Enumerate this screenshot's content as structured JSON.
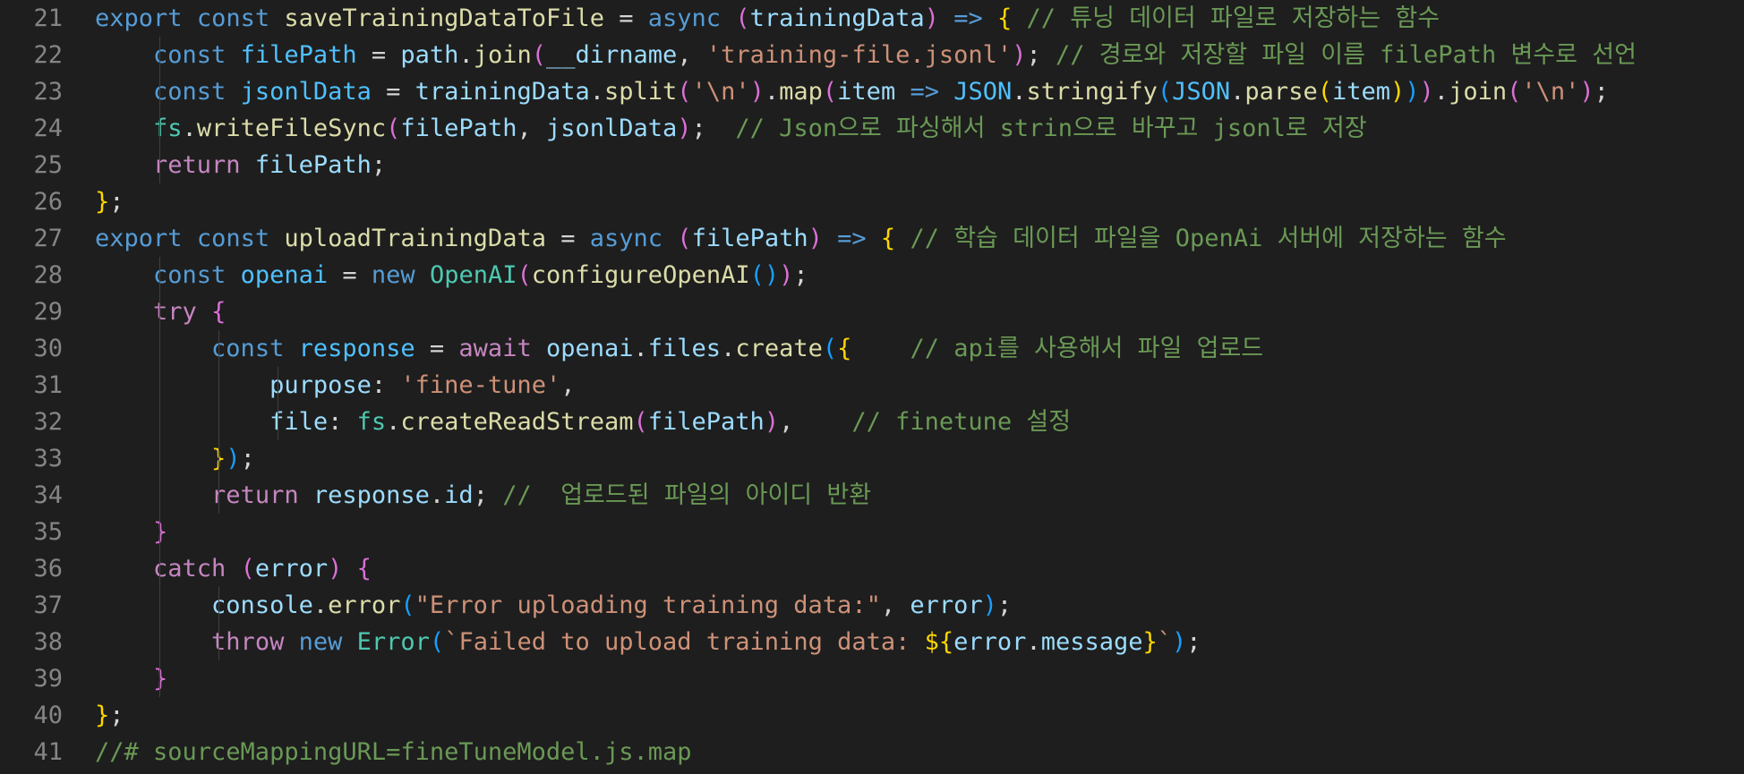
{
  "editor": {
    "theme_colors": {
      "background": "#1e1e1e",
      "line_number": "#858585",
      "keyword": "#569cd6",
      "control": "#c586c0",
      "function": "#dcdcaa",
      "variable": "#9cdcfe",
      "constant": "#4fc1ff",
      "type": "#4ec9b0",
      "string": "#ce9178",
      "comment": "#6a9955",
      "bracket_1": "#ffd700",
      "bracket_2": "#da70d6",
      "bracket_3": "#179fff"
    },
    "lines": [
      {
        "num": "21",
        "indent": 0,
        "tokens": [
          [
            "kw",
            "export"
          ],
          [
            "plain",
            " "
          ],
          [
            "kw",
            "const"
          ],
          [
            "plain",
            " "
          ],
          [
            "fn",
            "saveTrainingDataToFile"
          ],
          [
            "plain",
            " = "
          ],
          [
            "kw",
            "async"
          ],
          [
            "plain",
            " "
          ],
          [
            "b2",
            "("
          ],
          [
            "var",
            "trainingData"
          ],
          [
            "b2",
            ")"
          ],
          [
            "plain",
            " "
          ],
          [
            "kw",
            "=>"
          ],
          [
            "plain",
            " "
          ],
          [
            "b1",
            "{"
          ],
          [
            "plain",
            " "
          ],
          [
            "cmt",
            "// 튜닝 데이터 파일로 저장하는 함수"
          ]
        ]
      },
      {
        "num": "22",
        "indent": 1,
        "tokens": [
          [
            "kw",
            "const"
          ],
          [
            "plain",
            " "
          ],
          [
            "const",
            "filePath"
          ],
          [
            "plain",
            " = "
          ],
          [
            "var",
            "path"
          ],
          [
            "plain",
            "."
          ],
          [
            "fn",
            "join"
          ],
          [
            "b2",
            "("
          ],
          [
            "var",
            "__dirname"
          ],
          [
            "plain",
            ", "
          ],
          [
            "str",
            "'training-file.jsonl'"
          ],
          [
            "b2",
            ")"
          ],
          [
            "plain",
            "; "
          ],
          [
            "cmt",
            "// 경로와 저장할 파일 이름 filePath 변수로 선언"
          ]
        ]
      },
      {
        "num": "23",
        "indent": 1,
        "tokens": [
          [
            "kw",
            "const"
          ],
          [
            "plain",
            " "
          ],
          [
            "const",
            "jsonlData"
          ],
          [
            "plain",
            " = "
          ],
          [
            "var",
            "trainingData"
          ],
          [
            "plain",
            "."
          ],
          [
            "fn",
            "split"
          ],
          [
            "b2",
            "("
          ],
          [
            "str",
            "'\\n'"
          ],
          [
            "b2",
            ")"
          ],
          [
            "plain",
            "."
          ],
          [
            "fn",
            "map"
          ],
          [
            "b2",
            "("
          ],
          [
            "var",
            "item"
          ],
          [
            "plain",
            " "
          ],
          [
            "kw",
            "=>"
          ],
          [
            "plain",
            " "
          ],
          [
            "const",
            "JSON"
          ],
          [
            "plain",
            "."
          ],
          [
            "fn",
            "stringify"
          ],
          [
            "b3",
            "("
          ],
          [
            "const",
            "JSON"
          ],
          [
            "plain",
            "."
          ],
          [
            "fn",
            "parse"
          ],
          [
            "b1",
            "("
          ],
          [
            "var",
            "item"
          ],
          [
            "b1",
            ")"
          ],
          [
            "b3",
            ")"
          ],
          [
            "b2",
            ")"
          ],
          [
            "plain",
            "."
          ],
          [
            "fn",
            "join"
          ],
          [
            "b2",
            "("
          ],
          [
            "str",
            "'\\n'"
          ],
          [
            "b2",
            ")"
          ],
          [
            "plain",
            ";"
          ]
        ]
      },
      {
        "num": "24",
        "indent": 1,
        "tokens": [
          [
            "type",
            "fs"
          ],
          [
            "plain",
            "."
          ],
          [
            "fn",
            "writeFileSync"
          ],
          [
            "b2",
            "("
          ],
          [
            "var",
            "filePath"
          ],
          [
            "plain",
            ", "
          ],
          [
            "var",
            "jsonlData"
          ],
          [
            "b2",
            ")"
          ],
          [
            "plain",
            ";  "
          ],
          [
            "cmt",
            "// Json으로 파싱해서 strin으로 바꾸고 jsonl로 저장"
          ]
        ]
      },
      {
        "num": "25",
        "indent": 1,
        "tokens": [
          [
            "ctrl",
            "return"
          ],
          [
            "plain",
            " "
          ],
          [
            "var",
            "filePath"
          ],
          [
            "plain",
            ";"
          ]
        ]
      },
      {
        "num": "26",
        "indent": 0,
        "tokens": [
          [
            "b1",
            "}"
          ],
          [
            "plain",
            ";"
          ]
        ]
      },
      {
        "num": "27",
        "indent": 0,
        "tokens": [
          [
            "kw",
            "export"
          ],
          [
            "plain",
            " "
          ],
          [
            "kw",
            "const"
          ],
          [
            "plain",
            " "
          ],
          [
            "fn",
            "uploadTrainingData"
          ],
          [
            "plain",
            " = "
          ],
          [
            "kw",
            "async"
          ],
          [
            "plain",
            " "
          ],
          [
            "b2",
            "("
          ],
          [
            "var",
            "filePath"
          ],
          [
            "b2",
            ")"
          ],
          [
            "plain",
            " "
          ],
          [
            "kw",
            "=>"
          ],
          [
            "plain",
            " "
          ],
          [
            "b1",
            "{"
          ],
          [
            "plain",
            " "
          ],
          [
            "cmt",
            "// 학습 데이터 파일을 OpenAi 서버에 저장하는 함수"
          ]
        ]
      },
      {
        "num": "28",
        "indent": 1,
        "tokens": [
          [
            "kw",
            "const"
          ],
          [
            "plain",
            " "
          ],
          [
            "const",
            "openai"
          ],
          [
            "plain",
            " = "
          ],
          [
            "kw",
            "new"
          ],
          [
            "plain",
            " "
          ],
          [
            "type",
            "OpenAI"
          ],
          [
            "b2",
            "("
          ],
          [
            "fn",
            "configureOpenAI"
          ],
          [
            "b3",
            "()"
          ],
          [
            "b2",
            ")"
          ],
          [
            "plain",
            ";"
          ]
        ]
      },
      {
        "num": "29",
        "indent": 1,
        "tokens": [
          [
            "ctrl",
            "try"
          ],
          [
            "plain",
            " "
          ],
          [
            "b2",
            "{"
          ]
        ]
      },
      {
        "num": "30",
        "indent": 2,
        "tokens": [
          [
            "kw",
            "const"
          ],
          [
            "plain",
            " "
          ],
          [
            "const",
            "response"
          ],
          [
            "plain",
            " = "
          ],
          [
            "ctrl",
            "await"
          ],
          [
            "plain",
            " "
          ],
          [
            "var",
            "openai"
          ],
          [
            "plain",
            "."
          ],
          [
            "var",
            "files"
          ],
          [
            "plain",
            "."
          ],
          [
            "fn",
            "create"
          ],
          [
            "b3",
            "("
          ],
          [
            "b1",
            "{"
          ],
          [
            "plain",
            "    "
          ],
          [
            "cmt",
            "// api를 사용해서 파일 업로드"
          ]
        ]
      },
      {
        "num": "31",
        "indent": 3,
        "tokens": [
          [
            "var",
            "purpose"
          ],
          [
            "plain",
            ": "
          ],
          [
            "str",
            "'fine-tune'"
          ],
          [
            "plain",
            ","
          ]
        ]
      },
      {
        "num": "32",
        "indent": 3,
        "tokens": [
          [
            "var",
            "file"
          ],
          [
            "plain",
            ": "
          ],
          [
            "type",
            "fs"
          ],
          [
            "plain",
            "."
          ],
          [
            "fn",
            "createReadStream"
          ],
          [
            "b2",
            "("
          ],
          [
            "var",
            "filePath"
          ],
          [
            "b2",
            ")"
          ],
          [
            "plain",
            ",    "
          ],
          [
            "cmt",
            "// finetune 설정"
          ]
        ]
      },
      {
        "num": "33",
        "indent": 2,
        "tokens": [
          [
            "b1",
            "}"
          ],
          [
            "b3",
            ")"
          ],
          [
            "plain",
            ";"
          ]
        ]
      },
      {
        "num": "34",
        "indent": 2,
        "tokens": [
          [
            "ctrl",
            "return"
          ],
          [
            "plain",
            " "
          ],
          [
            "var",
            "response"
          ],
          [
            "plain",
            "."
          ],
          [
            "var",
            "id"
          ],
          [
            "plain",
            "; "
          ],
          [
            "cmt",
            "//  업로드된 파일의 아이디 반환"
          ]
        ]
      },
      {
        "num": "35",
        "indent": 1,
        "tokens": [
          [
            "b2",
            "}"
          ]
        ]
      },
      {
        "num": "36",
        "indent": 1,
        "tokens": [
          [
            "ctrl",
            "catch"
          ],
          [
            "plain",
            " "
          ],
          [
            "b2",
            "("
          ],
          [
            "var",
            "error"
          ],
          [
            "b2",
            ")"
          ],
          [
            "plain",
            " "
          ],
          [
            "b2",
            "{"
          ]
        ]
      },
      {
        "num": "37",
        "indent": 2,
        "tokens": [
          [
            "var",
            "console"
          ],
          [
            "plain",
            "."
          ],
          [
            "fn",
            "error"
          ],
          [
            "b3",
            "("
          ],
          [
            "str",
            "\"Error uploading training data:\""
          ],
          [
            "plain",
            ", "
          ],
          [
            "var",
            "error"
          ],
          [
            "b3",
            ")"
          ],
          [
            "plain",
            ";"
          ]
        ]
      },
      {
        "num": "38",
        "indent": 2,
        "tokens": [
          [
            "ctrl",
            "throw"
          ],
          [
            "plain",
            " "
          ],
          [
            "kw",
            "new"
          ],
          [
            "plain",
            " "
          ],
          [
            "type",
            "Error"
          ],
          [
            "b3",
            "("
          ],
          [
            "str",
            "`Failed to upload training data: "
          ],
          [
            "b1",
            "${"
          ],
          [
            "var",
            "error"
          ],
          [
            "plain",
            "."
          ],
          [
            "var",
            "message"
          ],
          [
            "b1",
            "}"
          ],
          [
            "str",
            "`"
          ],
          [
            "b3",
            ")"
          ],
          [
            "plain",
            ";"
          ]
        ]
      },
      {
        "num": "39",
        "indent": 1,
        "tokens": [
          [
            "b2",
            "}"
          ]
        ]
      },
      {
        "num": "40",
        "indent": 0,
        "tokens": [
          [
            "b1",
            "}"
          ],
          [
            "plain",
            ";"
          ]
        ]
      },
      {
        "num": "41",
        "indent": 0,
        "tokens": [
          [
            "cmt",
            "//# sourceMappingURL=fineTuneModel.js.map"
          ]
        ]
      }
    ]
  }
}
